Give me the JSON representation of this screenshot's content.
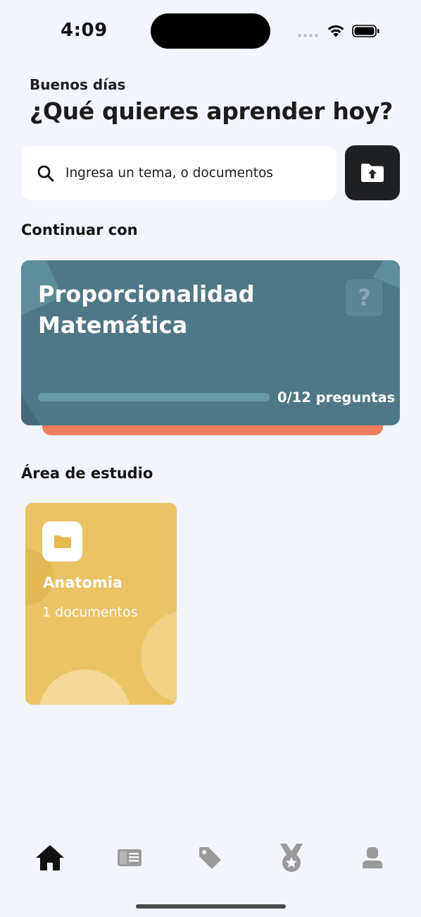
{
  "status_bar": {
    "time": "4:09"
  },
  "header": {
    "greeting": "Buenos días",
    "headline": "¿Qué quieres aprender hoy?"
  },
  "search": {
    "text": "Ingresa un tema, o documentos",
    "icon": "search-icon",
    "upload_icon": "folder-upload-icon"
  },
  "continue_section": {
    "title": "Continuar con",
    "card": {
      "title": "Proporcionalidad Matemática",
      "help_glyph": "?",
      "progress": 0,
      "progress_text": "0/12 preguntas"
    }
  },
  "study_area": {
    "title": "Área de estudio",
    "folders": [
      {
        "name": "Anatomia",
        "count": "1 documentos",
        "icon": "folder-icon"
      }
    ]
  },
  "tab_bar": {
    "items": [
      {
        "name": "home",
        "icon": "home-icon",
        "active": true
      },
      {
        "name": "library",
        "icon": "book-icon",
        "active": false
      },
      {
        "name": "tags",
        "icon": "tag-icon",
        "active": false
      },
      {
        "name": "achievements",
        "icon": "medal-icon",
        "active": false
      },
      {
        "name": "profile",
        "icon": "user-icon",
        "active": false
      }
    ]
  },
  "colors": {
    "background": "#f2f5fb",
    "card": "#4e7887",
    "card_accent": "#ec7d5d",
    "folder": "#eac365",
    "tab_active": "#111111",
    "tab_inactive": "#9a9a9a"
  }
}
